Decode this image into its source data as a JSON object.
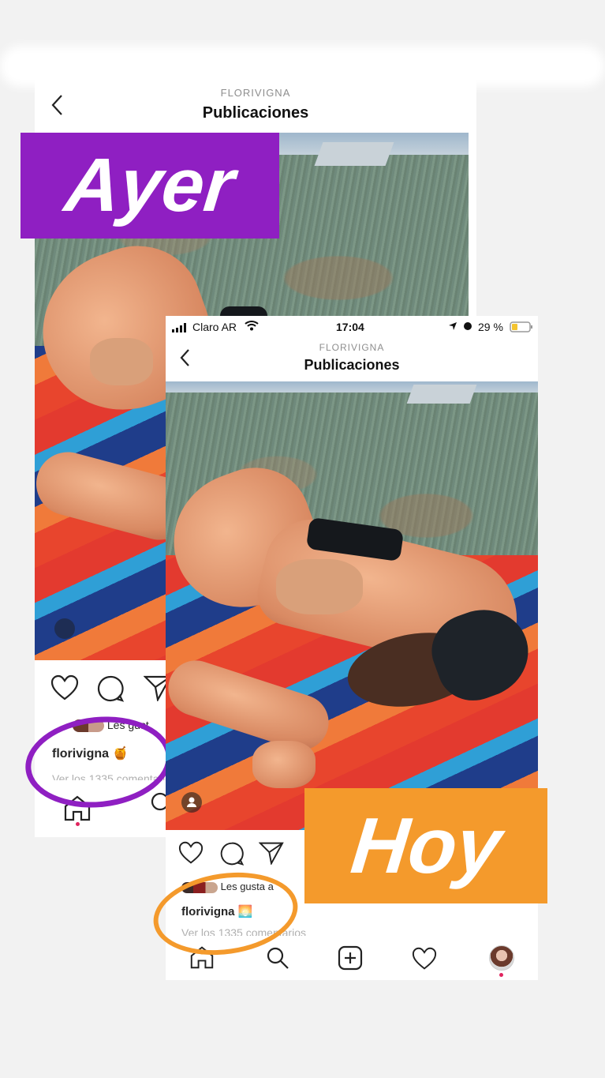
{
  "back_card": {
    "header_user": "FLORIVIGNA",
    "header_title": "Publicaciones",
    "likes_text": "Les gust",
    "username": "florivigna",
    "caption_emoji": "🍯",
    "comments_text": "Ver los 1335 comentarios"
  },
  "label_ayer": {
    "text": "Ayer",
    "color": "#8f1fc2"
  },
  "front_card": {
    "status": {
      "carrier": "Claro AR",
      "time": "17:04",
      "battery": "29 %"
    },
    "header_user": "FLORIVIGNA",
    "header_title": "Publicaciones",
    "likes_text": "Les gusta a",
    "username": "florivigna",
    "caption_emoji": "🌅",
    "comments_text": "Ver los 1335 comentarios"
  },
  "label_hoy": {
    "text": "Hoy",
    "color": "#f49a2c"
  },
  "icons": [
    "chevron-left-icon",
    "heart-icon",
    "comment-icon",
    "share-icon",
    "home-icon",
    "search-icon",
    "add-icon",
    "activity-icon",
    "profile-avatar-icon",
    "user-tag-icon",
    "wifi-icon",
    "signal-icon",
    "location-icon",
    "alarm-icon",
    "battery-icon"
  ]
}
